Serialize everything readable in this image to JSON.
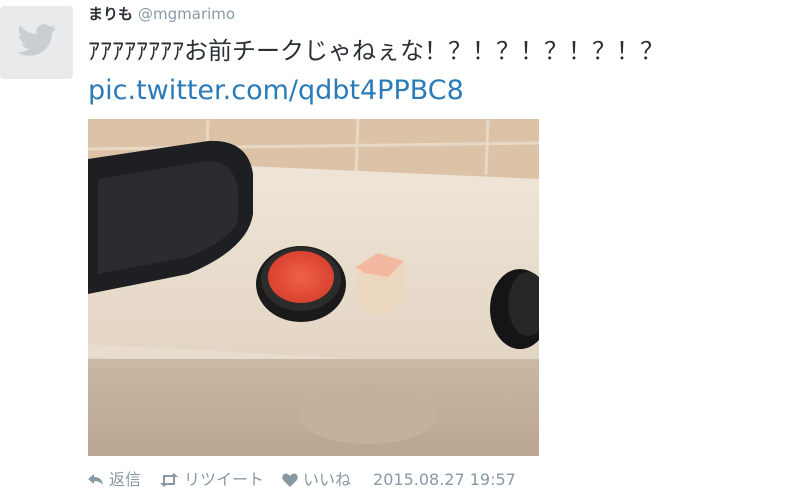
{
  "user": {
    "display_name": "まりも",
    "handle": "@mgmarimo"
  },
  "tweet": {
    "text": "ｱｱｱｱｱｱｱｱお前チークじゃねぇな！？！？！？！？！？",
    "link": "pic.twitter.com/qdbt4PPBC8"
  },
  "actions": {
    "reply_label": "返信",
    "retweet_label": "リツイート",
    "like_label": "いいね",
    "timestamp": "2015.08.27 19:57"
  },
  "colors": {
    "link": "#2b7bb9",
    "muted": "#8899a6",
    "text": "#292f33"
  },
  "icons": [
    "twitter-bird-icon",
    "reply-icon",
    "retweet-icon",
    "heart-icon"
  ]
}
